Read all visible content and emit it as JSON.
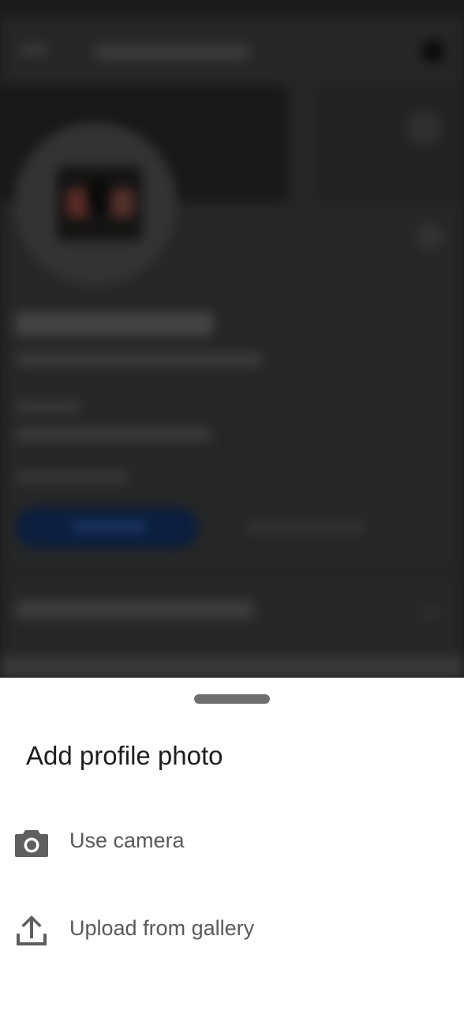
{
  "bottom_sheet": {
    "title": "Add profile photo",
    "options": [
      {
        "label": "Use camera",
        "icon": "camera-icon"
      },
      {
        "label": "Upload from gallery",
        "icon": "upload-icon"
      }
    ]
  },
  "colors": {
    "sheet_background": "#ffffff",
    "title_text": "#1e1e1e",
    "option_text": "#595959",
    "icon": "#5f5f5f",
    "drag_handle": "#6e6e6e",
    "scrim": "#262626"
  }
}
